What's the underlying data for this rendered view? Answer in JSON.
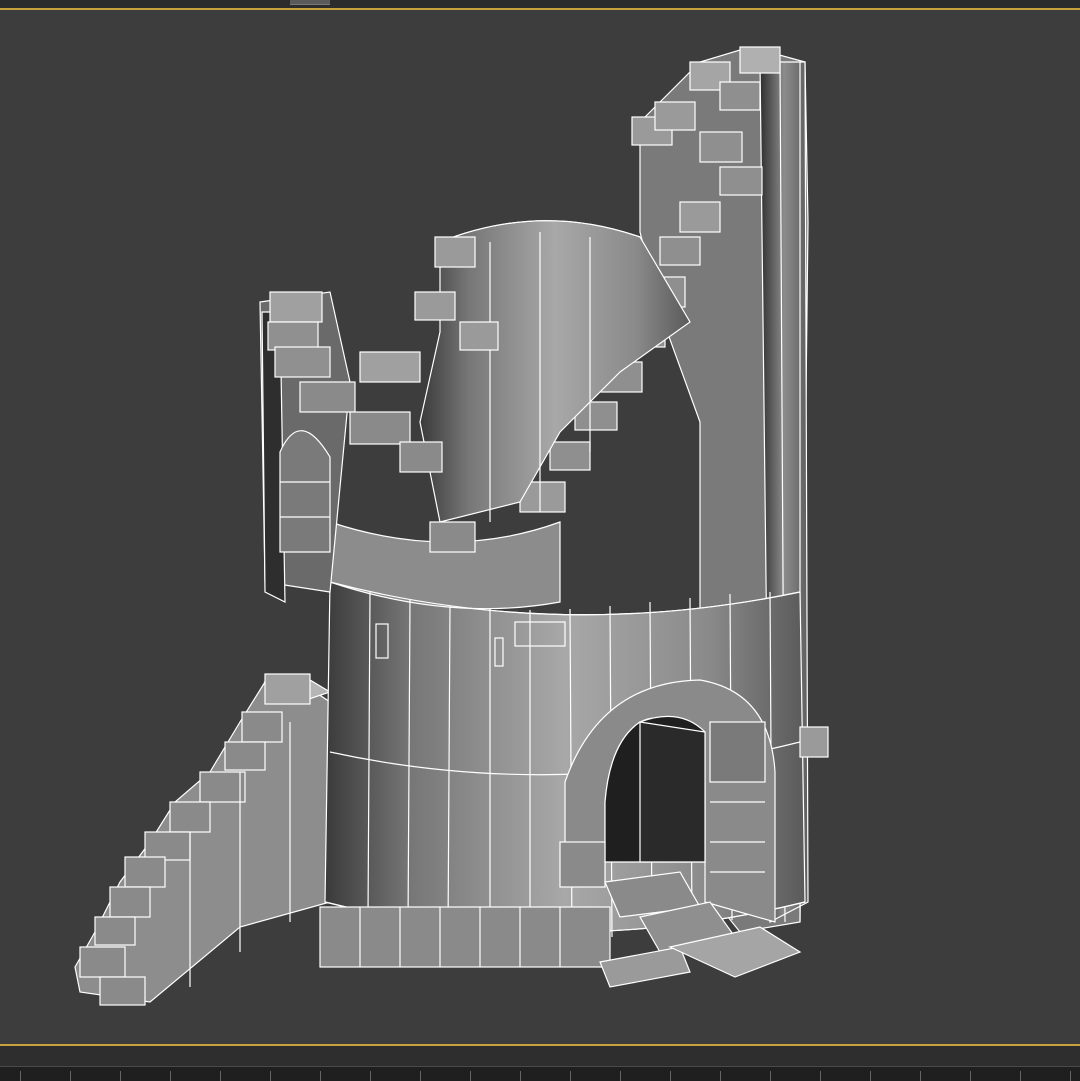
{
  "app": {
    "viewport_label": "",
    "mode": "wireframe-on-shaded"
  },
  "colors": {
    "viewport_bg": "#3d3d3d",
    "active_border": "#c8a23a",
    "wire": "#ffffff",
    "mesh_light": "#9a9a9a",
    "mesh_dark": "#555555"
  },
  "scene": {
    "object": "ruined-stone-tower",
    "icon": "tower-mesh"
  }
}
